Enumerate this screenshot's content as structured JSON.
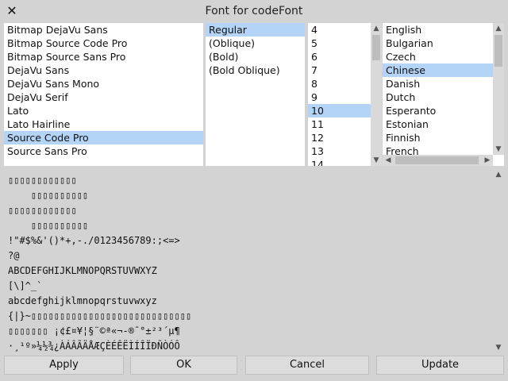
{
  "window": {
    "title": "Font for codeFont",
    "close_icon": "close-icon"
  },
  "families": {
    "items": [
      "Bitmap DejaVu Sans",
      "Bitmap Source Code Pro",
      "Bitmap Source Sans Pro",
      "DejaVu Sans",
      "DejaVu Sans Mono",
      "DejaVu Serif",
      "Lato",
      "Lato Hairline",
      "Source Code Pro",
      "Source Sans Pro"
    ],
    "selected": "Source Code Pro"
  },
  "styles": {
    "items": [
      "Regular",
      "(Oblique)",
      "(Bold)",
      "(Bold Oblique)"
    ],
    "selected": "Regular"
  },
  "sizes": {
    "items": [
      "4",
      "5",
      "6",
      "7",
      "8",
      "9",
      "10",
      "11",
      "12",
      "13",
      "14"
    ],
    "selected": "10"
  },
  "languages": {
    "items": [
      "English",
      "Bulgarian",
      "Czech",
      "Chinese",
      "Danish",
      "Dutch",
      "Esperanto",
      "Estonian",
      "Finnish",
      "French"
    ],
    "selected": "Chinese"
  },
  "preview": {
    "lines": [
      "▯▯▯▯▯▯▯▯▯▯▯▯",
      "    ▯▯▯▯▯▯▯▯▯▯",
      "▯▯▯▯▯▯▯▯▯▯▯▯",
      "    ▯▯▯▯▯▯▯▯▯▯",
      "!\"#$%&'()*+,-./0123456789:;<=>",
      "?@",
      "ABCDEFGHIJKLMNOPQRSTUVWXYZ",
      "[\\]^_`",
      "abcdefghijklmnopqrstuvwxyz",
      "{|}~▯▯▯▯▯▯▯▯▯▯▯▯▯▯▯▯▯▯▯▯▯▯▯▯▯▯▯▯",
      "▯▯▯▯▯▯▯ ¡¢£¤¥¦§¨©ª«¬-®¯°±²³´µ¶",
      "·¸¹º»¼½¾¿ÀÁÂÃÄÅÆÇÈÉÊËÌÍÎÏÐÑÒÓÔ"
    ]
  },
  "buttons": {
    "apply": "Apply",
    "ok": "OK",
    "cancel": "Cancel",
    "update": "Update"
  },
  "scroll_icons": {
    "up": "▲",
    "down": "▼",
    "left": "◀",
    "right": "▶"
  }
}
